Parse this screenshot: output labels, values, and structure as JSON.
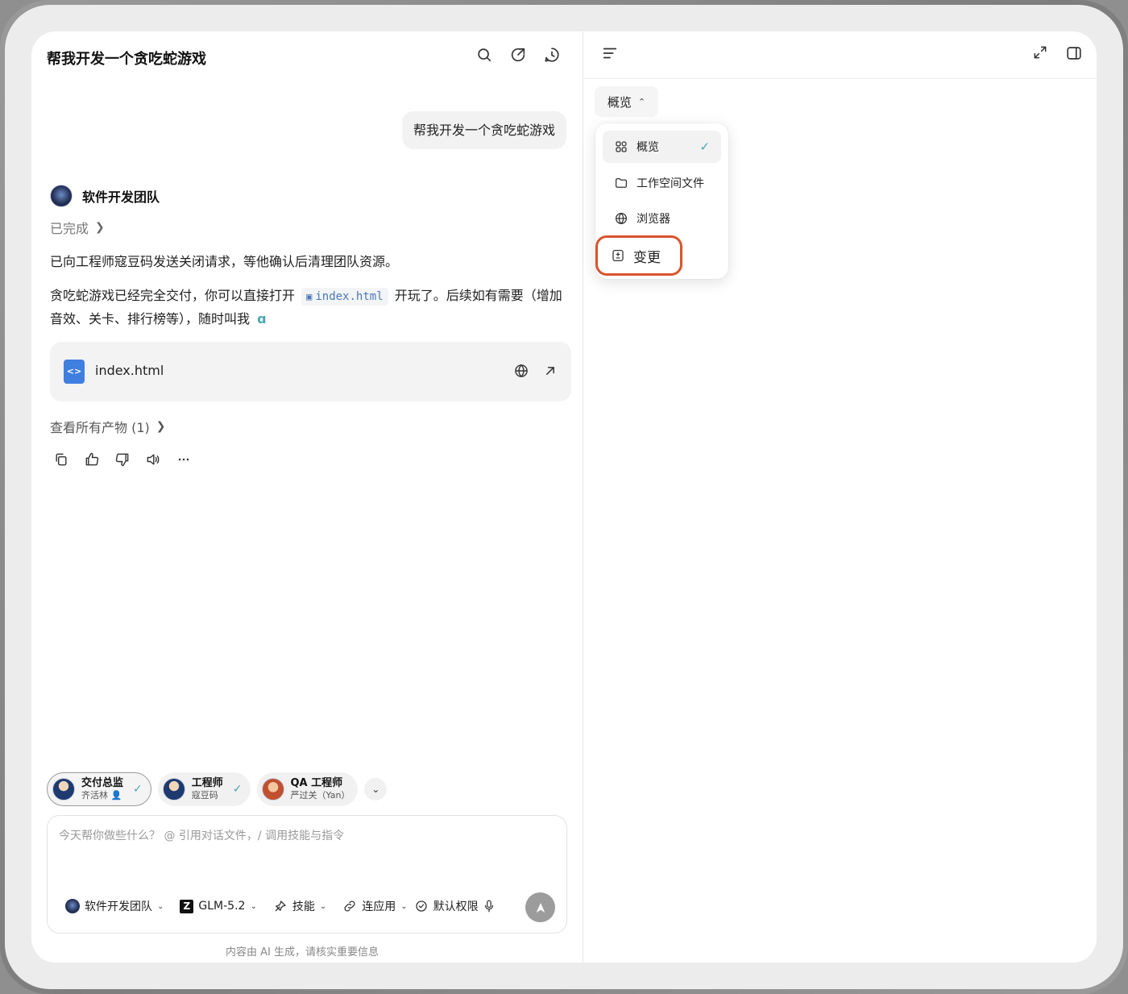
{
  "chat": {
    "title": "帮我开发一个贪吃蛇游戏",
    "user_message": "帮我开发一个贪吃蛇游戏",
    "agent_name": "软件开发团队",
    "status": "已完成",
    "paragraph1": "已向工程师寇豆码发送关闭请求，等他确认后清理团队资源。",
    "paragraph2_before": "贪吃蛇游戏已经完全交付，你可以直接打开",
    "paragraph2_code": "index.html",
    "paragraph2_after": "开玩了。后续如有需要（增加音效、关卡、排行榜等），随时叫我",
    "file_card_name": "index.html",
    "all_products": "查看所有产物 (1)"
  },
  "agents": [
    {
      "title": "交付总监",
      "subtitle": "齐活林"
    },
    {
      "title": "工程师",
      "subtitle": "寇豆码"
    },
    {
      "title": "QA 工程师",
      "subtitle": "严过关（Yan）"
    }
  ],
  "input": {
    "placeholder": "今天帮你做些什么？ @ 引用对话文件，/ 调用技能与指令",
    "team": "软件开发团队",
    "model": "GLM-5.2",
    "skills": "技能",
    "connect": "连应用",
    "permission": "默认权限",
    "footer_note": "内容由 AI 生成，请核实重要信息"
  },
  "right_panel": {
    "view_label": "概览",
    "menu": [
      {
        "label": "概览",
        "icon": "grid-icon",
        "selected": true
      },
      {
        "label": "工作空间文件",
        "icon": "folder-icon",
        "selected": false
      },
      {
        "label": "浏览器",
        "icon": "globe-icon",
        "selected": false
      },
      {
        "label": "变更",
        "icon": "diff-icon",
        "selected": false,
        "highlighted": true
      }
    ]
  },
  "colors": {
    "accent_check": "#47a6b0",
    "highlight_border": "#d9542c",
    "file_icon": "#3f7fe0"
  }
}
